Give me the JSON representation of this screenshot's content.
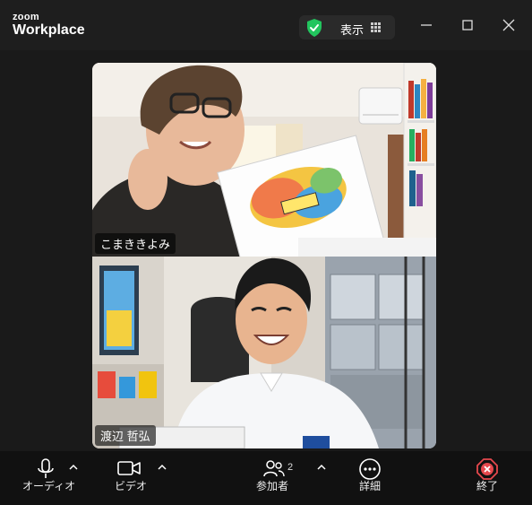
{
  "titlebar": {
    "brand_small": "zoom",
    "brand_large": "Workplace",
    "view_label": "表示"
  },
  "participants": [
    {
      "name": "こまききよみ"
    },
    {
      "name": "渡辺 哲弘"
    }
  ],
  "toolbar": {
    "audio_label": "オーディオ",
    "video_label": "ビデオ",
    "participants_label": "参加者",
    "participants_count": "2",
    "more_label": "詳細",
    "end_label": "終了"
  },
  "colors": {
    "shield": "#22c55e",
    "end_button": "#e5484d",
    "background": "#1a1a1a"
  }
}
